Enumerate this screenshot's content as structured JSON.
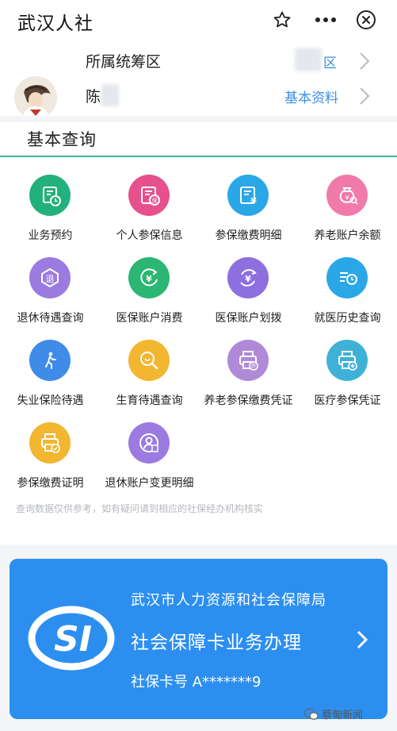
{
  "app": {
    "title": "武汉人社"
  },
  "titlebar": {
    "icons": [
      "star-icon",
      "more-icon",
      "close-icon"
    ]
  },
  "profile": {
    "region_label": "所属统筹区",
    "region_value_suffix": "区",
    "name_prefix": "陈",
    "basic_info_link": "基本资料"
  },
  "section": {
    "title": "基本查询"
  },
  "services": [
    {
      "label": "业务预约",
      "color": "#22b07d",
      "icon": "calendar-clock-icon"
    },
    {
      "label": "个人参保信息",
      "color": "#e6508c",
      "icon": "insurance-doc-icon"
    },
    {
      "label": "参保缴费明细",
      "color": "#2aa7e6",
      "icon": "yuan-doc-icon"
    },
    {
      "label": "养老账户余额",
      "color": "#f07aa9",
      "icon": "money-bag-icon"
    },
    {
      "label": "退休待遇查询",
      "color": "#9b7be0",
      "icon": "retire-badge-icon"
    },
    {
      "label": "医保账户消费",
      "color": "#2bb673",
      "icon": "yuan-arrow-icon"
    },
    {
      "label": "医保账户划拨",
      "color": "#8d6fe0",
      "icon": "yuan-cycle-icon"
    },
    {
      "label": "就医历史查询",
      "color": "#2aa7e6",
      "icon": "history-list-icon"
    },
    {
      "label": "失业保险待遇",
      "color": "#3f8be8",
      "icon": "walking-person-icon"
    },
    {
      "label": "生育待遇查询",
      "color": "#f2b631",
      "icon": "baby-search-icon"
    },
    {
      "label": "养老参保缴费凭证",
      "color": "#b08ad8",
      "icon": "printer-pension-icon"
    },
    {
      "label": "医疗参保凭证",
      "color": "#3fb1d6",
      "icon": "printer-medical-icon"
    },
    {
      "label": "参保缴费证明",
      "color": "#f2b631",
      "icon": "printer-proof-icon"
    },
    {
      "label": "退休账户变更明细",
      "color": "#9b7be0",
      "icon": "person-doc-icon"
    }
  ],
  "note": "查询数据仅供参考，如有疑问请到相应的社保经办机构核实",
  "card": {
    "org": "武汉市人力资源和社会保障局",
    "service": "社会保障卡业务办理",
    "card_number": "社保卡号 A*******9",
    "logo_text": "SI"
  },
  "watermark": {
    "text": "蔡甸新闻"
  },
  "colors": {
    "accent": "#3bb4a0",
    "card": "#2c8ff0",
    "link": "#3a8ee6"
  }
}
